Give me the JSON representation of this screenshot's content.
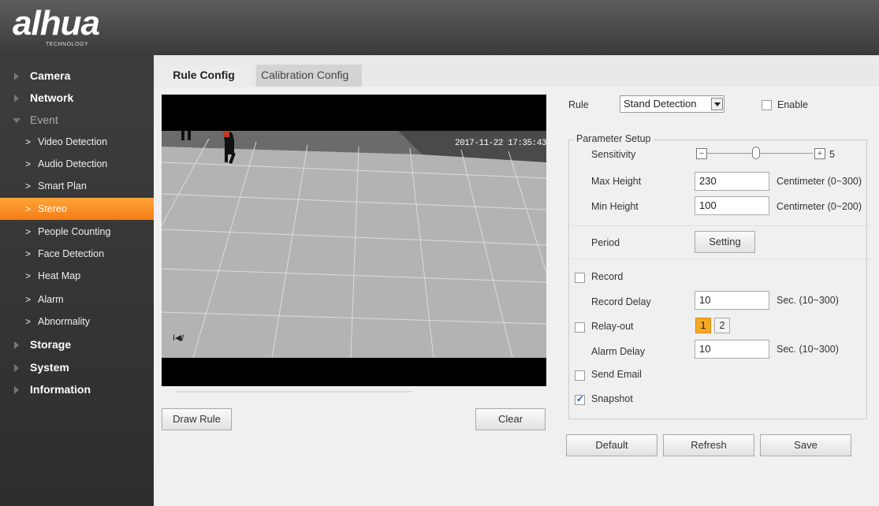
{
  "brand": {
    "logo_text": "alhua",
    "logo_sub": "TECHNOLOGY"
  },
  "sidebar": {
    "items": [
      {
        "label": "Camera",
        "level": "top",
        "state": "collapsed"
      },
      {
        "label": "Network",
        "level": "top",
        "state": "collapsed"
      },
      {
        "label": "Event",
        "level": "top",
        "state": "expanded"
      },
      {
        "label": "Video Detection",
        "level": "sub"
      },
      {
        "label": "Audio Detection",
        "level": "sub"
      },
      {
        "label": "Smart Plan",
        "level": "sub"
      },
      {
        "label": "Stereo",
        "level": "sub",
        "active": true
      },
      {
        "label": "People Counting",
        "level": "sub"
      },
      {
        "label": "Face Detection",
        "level": "sub"
      },
      {
        "label": "Heat Map",
        "level": "sub"
      },
      {
        "label": "Alarm",
        "level": "sub"
      },
      {
        "label": "Abnormality",
        "level": "sub"
      },
      {
        "label": "Storage",
        "level": "top",
        "state": "collapsed"
      },
      {
        "label": "System",
        "level": "top",
        "state": "collapsed"
      },
      {
        "label": "Information",
        "level": "top",
        "state": "collapsed"
      }
    ]
  },
  "tabs": [
    {
      "label": "Rule Config",
      "active": true
    },
    {
      "label": "Calibration Config",
      "active": false
    }
  ],
  "video": {
    "timestamp": "2017-11-22 17:35:43",
    "corner_mark": "I◀/"
  },
  "buttons": {
    "draw_rule": "Draw Rule",
    "clear": "Clear",
    "setting": "Setting",
    "default": "Default",
    "refresh": "Refresh",
    "save": "Save"
  },
  "rule": {
    "label": "Rule",
    "selected": "Stand Detection",
    "enable_label": "Enable",
    "enable_checked": false
  },
  "parameter_setup": {
    "legend": "Parameter Setup",
    "sensitivity_label": "Sensitivity",
    "sensitivity_value": "5",
    "sensitivity_minus": "−",
    "sensitivity_plus": "+",
    "max_height_label": "Max Height",
    "max_height_value": "230",
    "max_height_unit": "Centimeter (0~300)",
    "min_height_label": "Min Height",
    "min_height_value": "100",
    "min_height_unit": "Centimeter (0~200)",
    "period_label": "Period",
    "record_label": "Record",
    "record_checked": false,
    "record_delay_label": "Record Delay",
    "record_delay_value": "10",
    "record_delay_unit": "Sec. (10~300)",
    "relay_out_label": "Relay-out",
    "relay_out_checked": false,
    "relay_options": [
      "1",
      "2"
    ],
    "alarm_delay_label": "Alarm Delay",
    "alarm_delay_value": "10",
    "alarm_delay_unit": "Sec. (10~300)",
    "send_email_label": "Send Email",
    "send_email_checked": false,
    "snapshot_label": "Snapshot",
    "snapshot_checked": true
  },
  "colors": {
    "accent": "#f47c14",
    "sidebar_bg": "#333333",
    "header_bg": "#4a4a4a"
  }
}
